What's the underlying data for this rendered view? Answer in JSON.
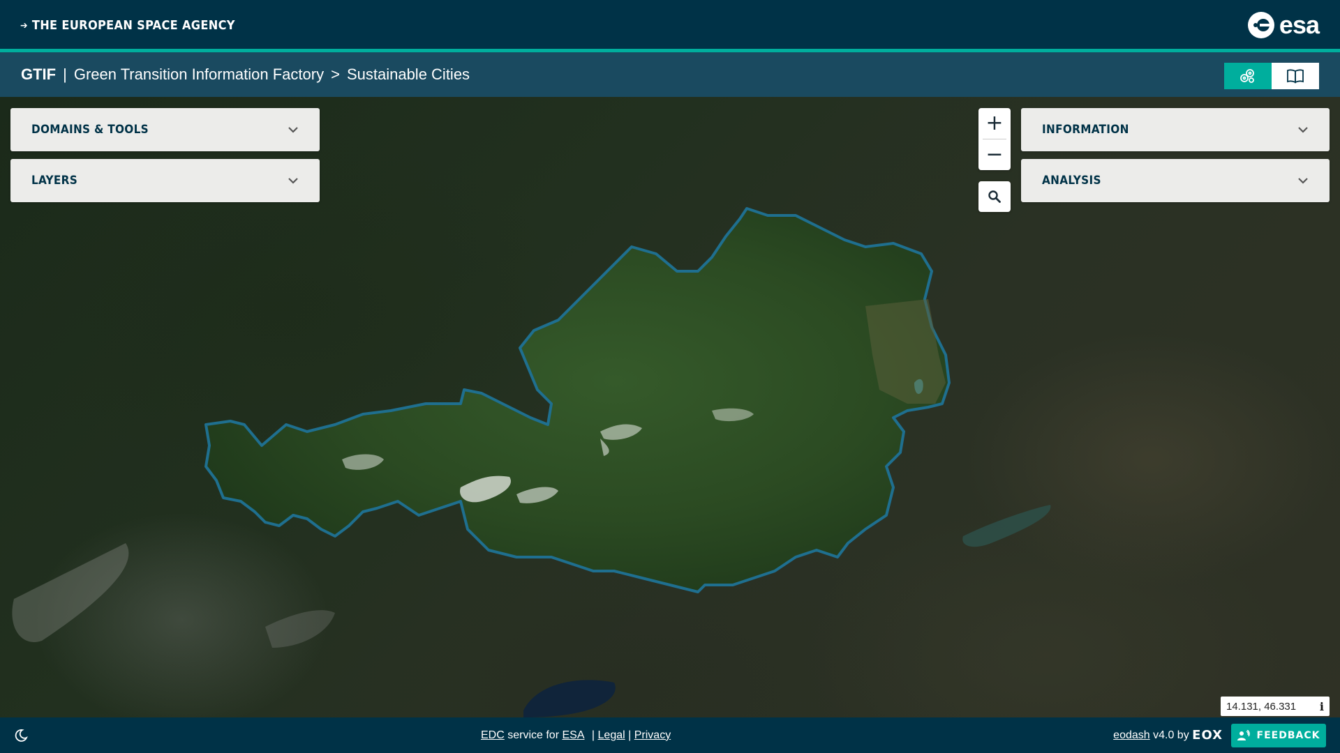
{
  "esa_header": {
    "link_label": "THE EUROPEAN SPACE AGENCY",
    "logo_text": "esa"
  },
  "app_header": {
    "brand": "GTIF",
    "separator": "|",
    "title": "Green Transition Information Factory",
    "crumb_separator": ">",
    "current": "Sustainable Cities",
    "modes": [
      {
        "icon": "satellite-cells-icon",
        "active": true
      },
      {
        "icon": "book-icon",
        "active": false
      }
    ]
  },
  "panels": {
    "domains_tools": "DOMAINS & TOOLS",
    "layers": "LAYERS",
    "information": "INFORMATION",
    "analysis": "ANALYSIS"
  },
  "map_controls": {
    "zoom_in": "+",
    "zoom_out": "−"
  },
  "coordinates": {
    "value": "14.131, 46.331",
    "info": "i"
  },
  "footer": {
    "edc": "EDC",
    "service_for": " service for ",
    "esa": "ESA",
    "pipe1": " | ",
    "legal": "Legal",
    "pipe2": " | ",
    "privacy": "Privacy",
    "eodash": "eodash",
    "version_by": " v4.0 by ",
    "eox": "EOX",
    "feedback": "FEEDBACK"
  },
  "colors": {
    "esa_navy": "#003247",
    "app_bar": "#1a4a60",
    "accent_teal": "#00ae9d",
    "panel_bg": "#ececea"
  }
}
